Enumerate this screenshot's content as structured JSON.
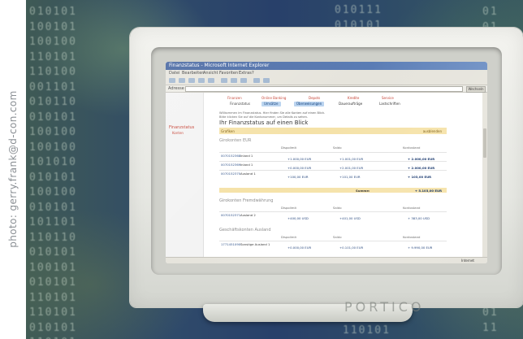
{
  "credit": "photo: gerry.frank@d-con.com",
  "background_binary": {
    "left_column": [
      "010101",
      "100101",
      "100100",
      "110101",
      "110100",
      "001101",
      "010110",
      "010101",
      "100100",
      "100100",
      "101010",
      "010101",
      "100100",
      "010101",
      "101101",
      "110110",
      "010101",
      "100101",
      "010101",
      "110101",
      "110101",
      "010101",
      "110101"
    ],
    "right_column": [
      "01",
      "01",
      "10",
      "11",
      "11",
      "11",
      "01",
      "10",
      "01",
      "10",
      "11",
      "01",
      "11",
      "01",
      "10",
      "10",
      "01",
      "11",
      "01",
      "10",
      "01",
      "11"
    ],
    "top_right": [
      "010111",
      "010101"
    ],
    "bottom": [
      "110101"
    ]
  },
  "monitor_brand": "PORTICO",
  "browser": {
    "title": "Finanzstatus - Microsoft Internet Explorer",
    "menu": [
      "Datei",
      "Bearbeiten",
      "Ansicht",
      "Favoriten",
      "Extras",
      "?"
    ],
    "address_label": "Adresse",
    "address_value": "",
    "go_label": "Wechseln zu",
    "status_left": "",
    "status_right": "Internet"
  },
  "page": {
    "nav_logo": "Finanzstatus",
    "nav_sub": "Konten",
    "tabs_primary": [
      "Finanzen",
      "Online Banking",
      "Depots",
      "Kredite",
      "Service"
    ],
    "tabs_secondary": [
      {
        "label": "Finanzstatus",
        "active": false
      },
      {
        "label": "Umsätze",
        "active": true
      },
      {
        "label": "Überweisungen",
        "active": true
      },
      {
        "label": "Daueraufträge",
        "active": false
      },
      {
        "label": "Lastschriften",
        "active": false
      }
    ],
    "intro_line1": "Willkommen im Finanzstatus. Hier finden Sie alle Konten auf einen Blick.",
    "intro_line2": "Bitte klicken Sie auf die Kontonummer, um Details zu sehen.",
    "title": "Ihr Finanzstatus auf einen Blick",
    "grafiken_label": "Grafiken",
    "grafiken_link": "ausblenden",
    "section_eur": "Girokonten EUR",
    "section_fw": "Girokonten Fremdwährung",
    "section_ausland": "Geschäftskonten Ausland",
    "columns": [
      "Dispolimit",
      "Saldo",
      "Kontostand"
    ],
    "eur_rows": [
      {
        "acct": "0070152368",
        "name": "Inland 1",
        "c1": "+1.000,00 EUR",
        "c2": "+1.001,00 EUR",
        "c3": "+ 2.000,00 EUR"
      },
      {
        "acct": "0070152369",
        "name": "Inland 1",
        "c1": "+0.000,00 EUR",
        "c2": "+2.001,00 EUR",
        "c3": "+ 2.000,00 EUR"
      },
      {
        "acct": "0070152370",
        "name": "Ausland 1",
        "c1": "+100,00 EUR",
        "c2": "+101,00 EUR",
        "c3": "+ 103,00 EUR"
      }
    ],
    "summe_label": "Summe:",
    "summe_value": "+ 5.103,00 EUR",
    "fw_rows": [
      {
        "acct": "0070152371",
        "name": "Ausland 2",
        "c1": "+400,00 USD",
        "c2": "+401,00 USD",
        "c3": "+ 383,00 USD"
      }
    ],
    "ausland_rows": [
      {
        "acct": "1771451090",
        "name": "Sonstige Ausland 1",
        "c1": "+0.000,00 EUR",
        "c2": "+0.101,00 EUR",
        "c3": "+ 9.990,00 EUR"
      }
    ]
  }
}
